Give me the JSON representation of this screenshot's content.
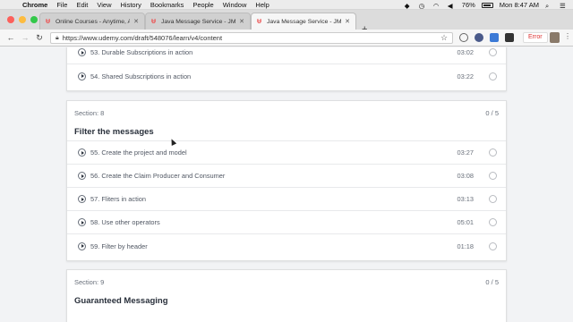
{
  "menubar": {
    "app": "Chrome",
    "items": [
      "File",
      "Edit",
      "View",
      "History",
      "Bookmarks",
      "People",
      "Window",
      "Help"
    ],
    "battery": "76%",
    "clock": "Mon 8:47 AM"
  },
  "tabs": [
    {
      "label": "Online Courses - Anytime, Any"
    },
    {
      "label": "Java Message Service - JMS C"
    },
    {
      "label": "Java Message Service - JMS C"
    }
  ],
  "toolbar": {
    "url": "https://www.udemy.com/draft/548076/learn/v4/content",
    "error_label": "Error"
  },
  "section_prev": {
    "lectures": [
      {
        "title": "53. Durable Subscriptions in action",
        "duration": "03:02"
      },
      {
        "title": "54. Shared Subscriptions in action",
        "duration": "03:22"
      }
    ]
  },
  "section8": {
    "label": "Section: 8",
    "progress": "0 / 5",
    "title": "Filter the messages",
    "lectures": [
      {
        "title": "55. Create the project and model",
        "duration": "03:27"
      },
      {
        "title": "56. Create the Claim Producer and Consumer",
        "duration": "03:08"
      },
      {
        "title": "57. Fliters in action",
        "duration": "03:13"
      },
      {
        "title": "58. Use other operators",
        "duration": "05:01"
      },
      {
        "title": "59. Filter by header",
        "duration": "01:18"
      }
    ]
  },
  "section9": {
    "label": "Section: 9",
    "progress": "0 / 5",
    "title": "Guaranteed Messaging"
  }
}
